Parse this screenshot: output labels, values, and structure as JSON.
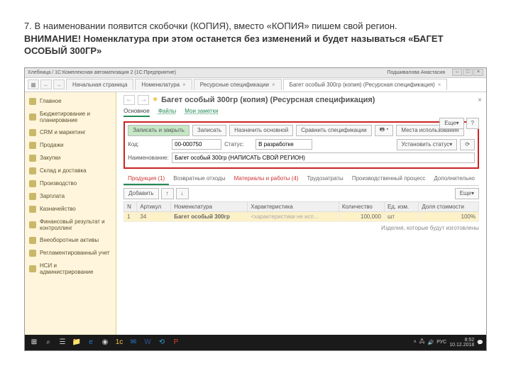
{
  "instruction": {
    "line1": "7. В наименовании появится скобочки (КОПИЯ), вместо «КОПИЯ» пишем свой регион.",
    "line2": "ВНИМАНИЕ! Номенклатура при этом останется без изменений и будет называться «БАГЕТ ОСОБЫЙ 300ГР»"
  },
  "title": "Хлебница / 1С:Комплексная автоматизация 2 (1С:Предприятие)",
  "user": "Подшивалова Анастасия",
  "tabs": {
    "t0": "Начальная страница",
    "t1": "Номенклатура",
    "t2": "Ресурсные спецификации",
    "t3": "Багет особый 300гр (копия) (Ресурсная спецификация)"
  },
  "sidebar": {
    "s0": "Главное",
    "s1": "Бюджетирование и планирование",
    "s2": "CRM и маркетинг",
    "s3": "Продажи",
    "s4": "Закупки",
    "s5": "Склад и доставка",
    "s6": "Производство",
    "s7": "Зарплата",
    "s8": "Казначейство",
    "s9": "Финансовый результат и контроллинг",
    "s10": "Внеоборотные активы",
    "s11": "Регламентированный учет",
    "s12": "НСИ и администрирование"
  },
  "form": {
    "title": "Багет особый 300гр (копия) (Ресурсная спецификация)",
    "sub0": "Основное",
    "sub1": "Файлы",
    "sub2": "Мои заметки",
    "save_close": "Записать и закрыть",
    "save": "Записать",
    "assign_main": "Назначить основной",
    "compare": "Сравнить спецификации",
    "places": "Места использования",
    "more": "Еще",
    "code_label": "Код:",
    "code": "00-000750",
    "status_label": "Статус:",
    "status": "В разработке",
    "set_status": "Установить статус",
    "name_label": "Наименование:",
    "name": "Багет особый 300гр (НАПИСАТЬ СВОЙ РЕГИОН)"
  },
  "tabs2": {
    "t0": "Продукция (1)",
    "t1": "Возвратные отходы",
    "t2": "Материалы и работы (4)",
    "t3": "Трудозатраты",
    "t4": "Производственный процесс",
    "t5": "Дополнительно"
  },
  "toolbar2": {
    "add": "Добавить",
    "more": "Еще"
  },
  "table": {
    "h0": "N",
    "h1": "Артикул",
    "h2": "Номенклатура",
    "h3": "Характеристика",
    "h4": "Количество",
    "h5": "Ед. изм.",
    "h6": "Доля стоимости",
    "r0": {
      "n": "1",
      "art": "34",
      "nom": "Багет особый 300гр",
      "char": "<характеристики не исп...",
      "qty": "100,000",
      "unit": "шт",
      "share": "100%"
    }
  },
  "note": "Изделия, которые будут изготовлены",
  "taskbar": {
    "lang": "РУС",
    "time": "8:52",
    "date": "10.12.2018"
  }
}
